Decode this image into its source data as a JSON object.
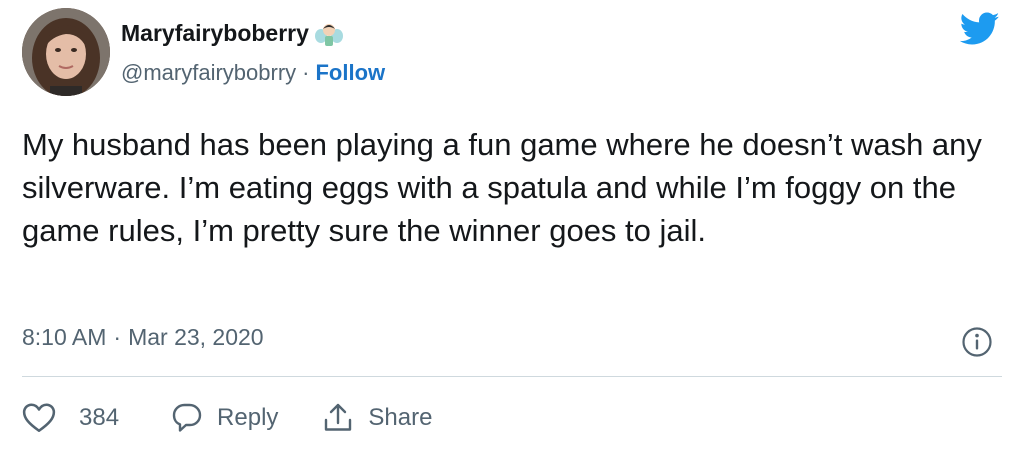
{
  "tweet": {
    "display_name": "Maryfairyboberry",
    "name_emoji": "fairy-emoji",
    "handle": "@maryfairybobrry",
    "separator": "·",
    "follow_label": "Follow",
    "text": "My husband has been playing a fun game where he doesn’t wash any silverware. I’m eating eggs with a spatula and while I’m foggy on the game rules, I’m pretty sure the winner goes to jail.",
    "time": "8:10 AM",
    "date": "Mar 23, 2020",
    "like_count": "384",
    "reply_label": "Reply",
    "share_label": "Share"
  },
  "icons": {
    "brand": "twitter-bird-icon",
    "info": "info-icon",
    "like": "heart-icon",
    "reply": "speech-bubble-icon",
    "share": "share-upload-icon"
  },
  "colors": {
    "accent": "#1b74c8",
    "twitter_blue": "#1d9bf0",
    "text": "#14171a",
    "secondary": "#536471",
    "divider": "#cfd9de"
  }
}
